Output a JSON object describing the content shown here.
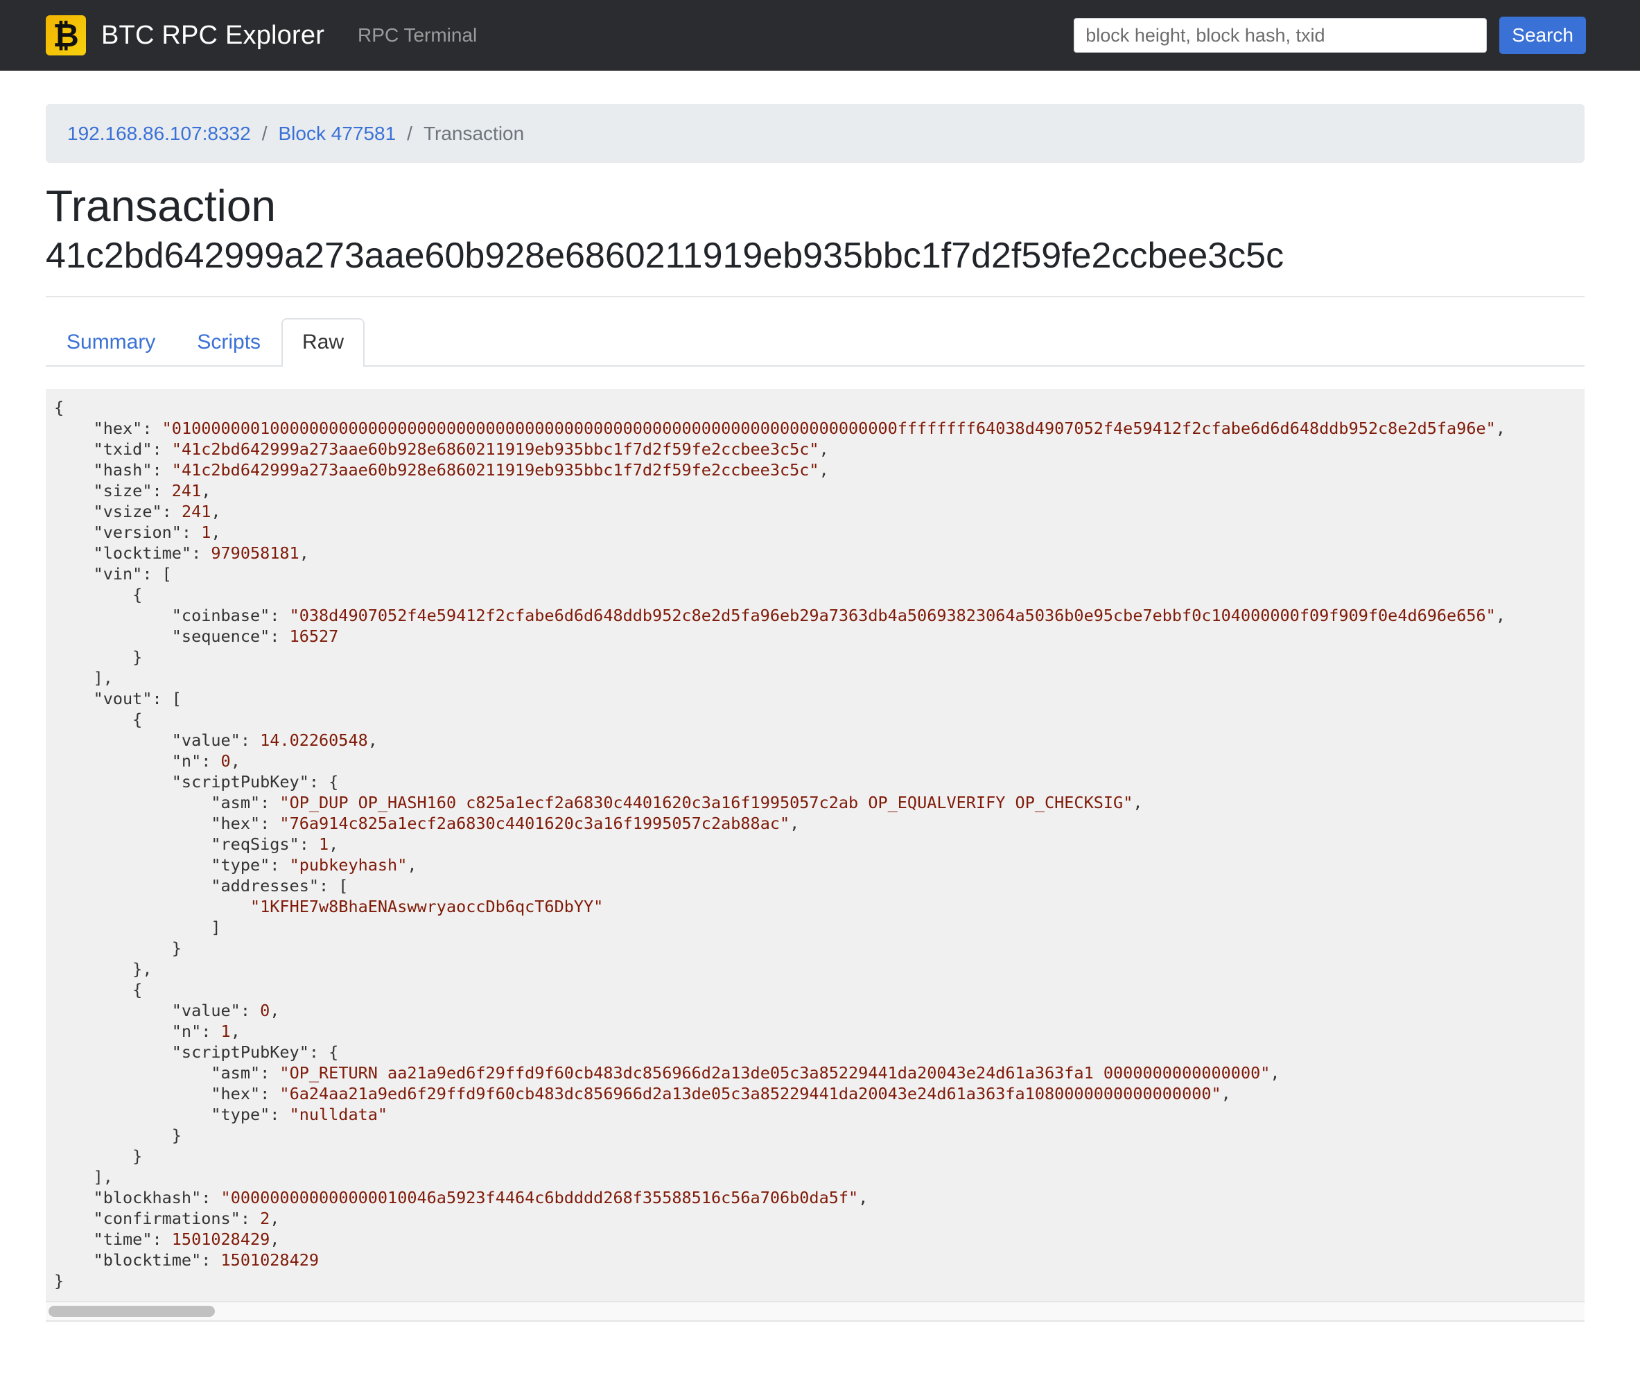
{
  "navbar": {
    "logo_icon": "bitcoin-icon",
    "logo_glyph": "₿",
    "brand": "BTC RPC Explorer",
    "links": [
      {
        "label": "RPC Terminal"
      }
    ],
    "search": {
      "placeholder": "block height, block hash, txid",
      "value": ""
    },
    "search_button": "Search"
  },
  "breadcrumb": {
    "items": [
      {
        "label": "192.168.86.107:8332",
        "link": true
      },
      {
        "label": "Block 477581",
        "link": true
      },
      {
        "label": "Transaction",
        "link": false
      }
    ],
    "separator": "/"
  },
  "page": {
    "title": "Transaction",
    "txid": "41c2bd642999a273aae60b928e6860211919eb935bbc1f7d2f59fe2ccbee3c5c"
  },
  "tabs": [
    {
      "label": "Summary",
      "active": false
    },
    {
      "label": "Scripts",
      "active": false
    },
    {
      "label": "Raw",
      "active": true
    }
  ],
  "raw": {
    "hex": "01000000010000000000000000000000000000000000000000000000000000000000000000ffffffff64038d4907052f4e59412f2cfabe6d6d648ddb952c8e2d5fa96e",
    "txid": "41c2bd642999a273aae60b928e6860211919eb935bbc1f7d2f59fe2ccbee3c5c",
    "hash": "41c2bd642999a273aae60b928e6860211919eb935bbc1f7d2f59fe2ccbee3c5c",
    "size": "241",
    "vsize": "241",
    "version": "1",
    "locktime": "979058181",
    "vin": [
      {
        "coinbase": "038d4907052f4e59412f2cfabe6d6d648ddb952c8e2d5fa96eb29a7363db4a50693823064a5036b0e95cbe7ebbf0c104000000f09f909f0e4d696e656",
        "sequence": "16527"
      }
    ],
    "vout": [
      {
        "value": "14.02260548",
        "n": "0",
        "scriptPubKey": {
          "asm": "OP_DUP OP_HASH160 c825a1ecf2a6830c4401620c3a16f1995057c2ab OP_EQUALVERIFY OP_CHECKSIG",
          "hex": "76a914c825a1ecf2a6830c4401620c3a16f1995057c2ab88ac",
          "reqSigs": "1",
          "type": "pubkeyhash",
          "addresses": [
            "1KFHE7w8BhaENAswwryaoccDb6qcT6DbYY"
          ]
        }
      },
      {
        "value": "0",
        "n": "1",
        "scriptPubKey": {
          "asm": "OP_RETURN aa21a9ed6f29ffd9f60cb483dc856966d2a13de05c3a85229441da20043e24d61a363fa1 0000000000000000",
          "hex": "6a24aa21a9ed6f29ffd9f60cb483dc856966d2a13de05c3a85229441da20043e24d61a363fa1080000000000000000",
          "type": "nulldata"
        }
      }
    ],
    "blockhash": "000000000000000010046a5923f4464c6bdddd268f35588516c56a706b0da5f",
    "confirmations": "2",
    "time": "1501028429",
    "blocktime": "1501028429"
  },
  "colors": {
    "navbar_bg": "#2b2c2f",
    "accent": "#3a71d6",
    "code_bg": "#f0f0f0",
    "json_value": "#7f1a08",
    "logo": "#f2b400"
  }
}
